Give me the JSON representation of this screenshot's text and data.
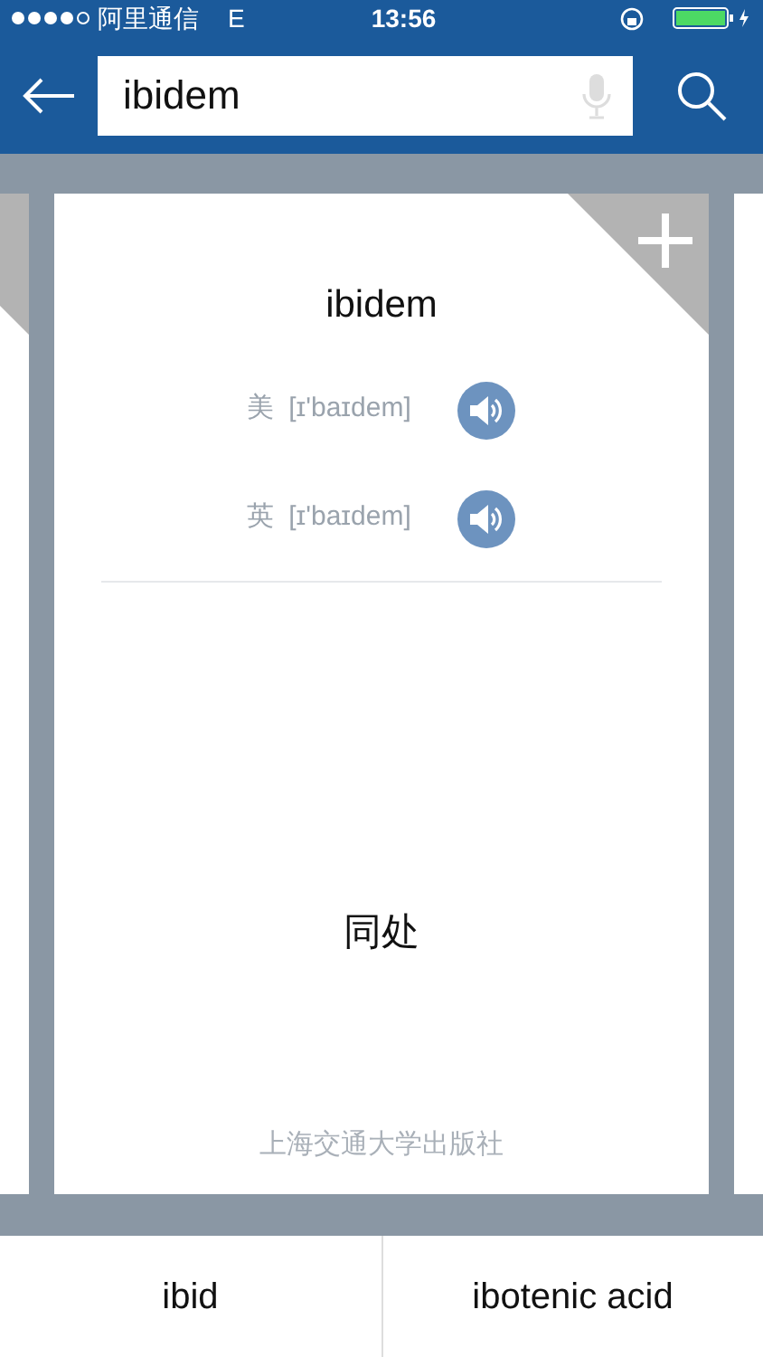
{
  "status_bar": {
    "carrier": "阿里通信",
    "network": "E",
    "time": "13:56"
  },
  "search": {
    "value": "ibidem"
  },
  "card": {
    "headword": "ibidem",
    "pronunciations": [
      {
        "region": "美",
        "phonetic": "[ɪ'baɪdem]"
      },
      {
        "region": "英",
        "phonetic": "[ɪ'baɪdem]"
      }
    ],
    "definition": "同处",
    "source": "上海交通大学出版社"
  },
  "neighbors": [
    "ibid",
    "ibotenic acid"
  ]
}
